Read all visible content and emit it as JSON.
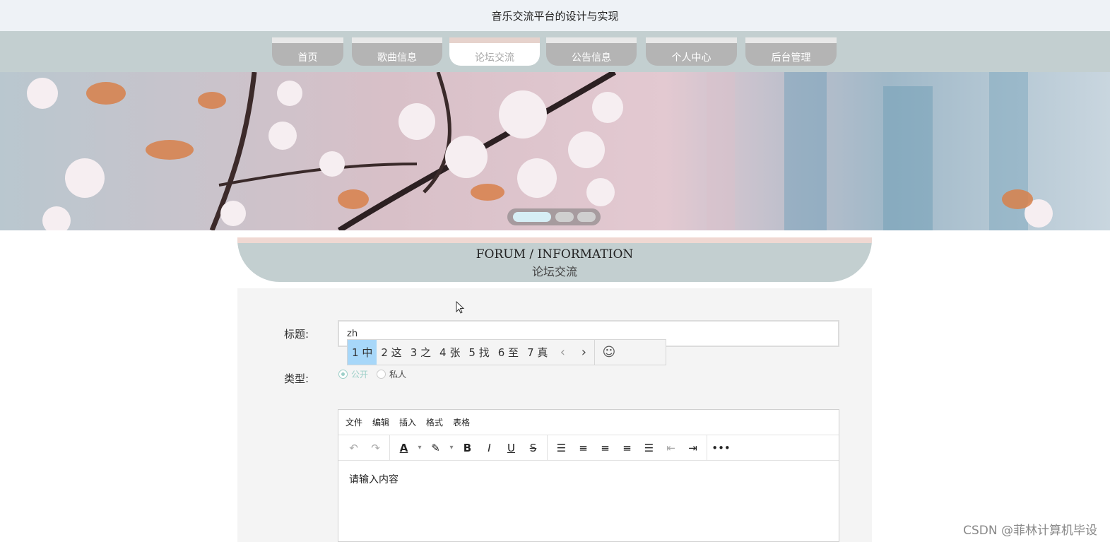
{
  "site": {
    "title": "音乐交流平台的设计与实现"
  },
  "nav": {
    "items": [
      {
        "label": "首页"
      },
      {
        "label": "歌曲信息"
      },
      {
        "label": "论坛交流"
      },
      {
        "label": "公告信息"
      },
      {
        "label": "个人中心"
      },
      {
        "label": "后台管理"
      }
    ],
    "active_index": 2
  },
  "carousel": {
    "slide_count": 3,
    "active_index": 0
  },
  "section": {
    "title_en": "FORUM / INFORMATION",
    "title_cn": "论坛交流"
  },
  "form": {
    "title_label": "标题:",
    "title_value": "zh",
    "type_label": "类型:",
    "type_options": [
      "公开",
      "私人"
    ],
    "type_selected": "公开"
  },
  "ime": {
    "candidates": [
      {
        "num": "1",
        "char": "中"
      },
      {
        "num": "2",
        "char": "这"
      },
      {
        "num": "3",
        "char": "之"
      },
      {
        "num": "4",
        "char": "张"
      },
      {
        "num": "5",
        "char": "找"
      },
      {
        "num": "6",
        "char": "至"
      },
      {
        "num": "7",
        "char": "真"
      }
    ],
    "selected_index": 0
  },
  "editor": {
    "menus": [
      "文件",
      "编辑",
      "插入",
      "格式",
      "表格"
    ],
    "placeholder": "请输入内容",
    "toolbar_icons": [
      "undo-icon",
      "redo-icon",
      "font-color-icon",
      "highlight-icon",
      "bold-icon",
      "italic-icon",
      "underline-icon",
      "strikethrough-icon",
      "line-height-icon",
      "align-left-icon",
      "align-center-icon",
      "align-right-icon",
      "align-justify-icon",
      "outdent-icon",
      "indent-icon",
      "more-icon"
    ]
  },
  "watermark": "CSDN @菲林计算机毕设",
  "colors": {
    "nav_bg": "#c3cfd0",
    "nav_item": "#b4b4b4",
    "accent_pink": "#f0d8d2",
    "radio_accent": "#9ccfc8",
    "ime_selected": "#a7d7f9"
  }
}
